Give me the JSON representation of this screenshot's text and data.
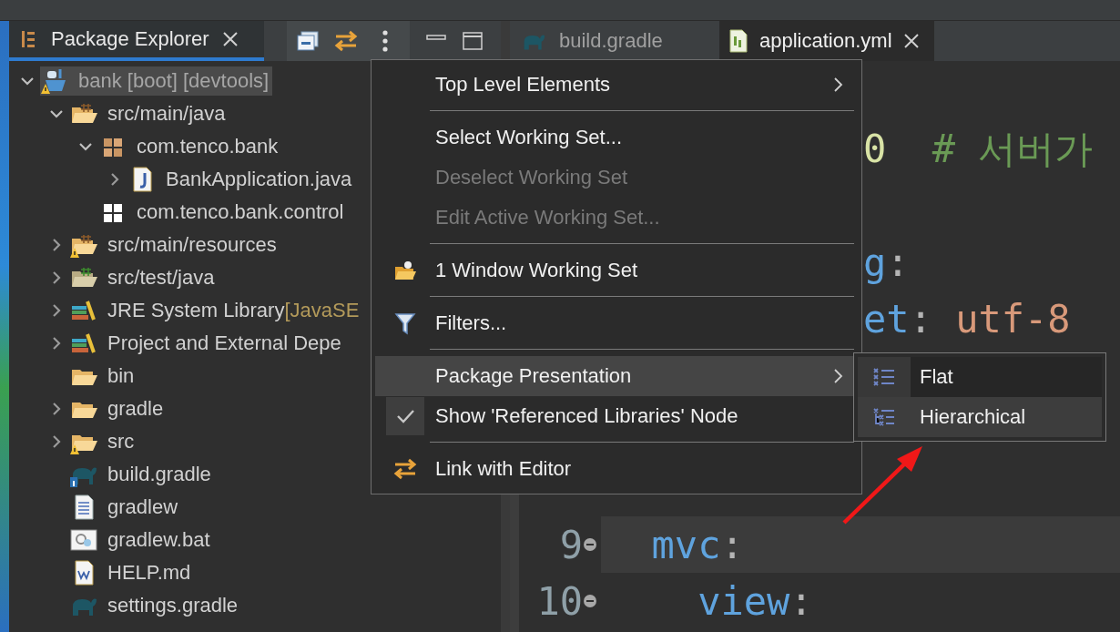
{
  "explorer": {
    "tabs": [
      {
        "label": "Package Explorer",
        "selected": true
      }
    ],
    "tree": [
      {
        "label": "bank [boot] [devtools]",
        "kind": "project",
        "warning": true,
        "expanded": true,
        "selected": true,
        "children": [
          {
            "label": "src/main/java",
            "kind": "source",
            "warning": false,
            "expanded": true,
            "selected": false,
            "children": [
              {
                "label": "com.tenco.bank",
                "kind": "package",
                "warning": false,
                "expanded": true,
                "selected": false,
                "children": [
                  {
                    "label": "BankApplication.java",
                    "kind": "java",
                    "warning": false,
                    "expanded": false,
                    "selected": false
                  }
                ]
              },
              {
                "label": "com.tenco.bank.control",
                "kind": "empty",
                "warning": false,
                "selected": false
              }
            ]
          },
          {
            "label": "src/main/resources",
            "kind": "source",
            "warning": true,
            "expanded": false,
            "selected": false
          },
          {
            "label": "src/test/java",
            "kind": "test",
            "warning": false,
            "expanded": false,
            "selected": false
          },
          {
            "label": "JRE System Library",
            "decoration": "[JavaSE",
            "kind": "library",
            "warning": false,
            "expanded": false,
            "selected": false
          },
          {
            "label": "Project and External Depe",
            "kind": "library",
            "warning": false,
            "expanded": false,
            "selected": false
          },
          {
            "label": "bin",
            "kind": "folder",
            "warning": false,
            "selected": false
          },
          {
            "label": "gradle",
            "kind": "folder",
            "warning": false,
            "expanded": false,
            "selected": false
          },
          {
            "label": "src",
            "kind": "folder",
            "warning": true,
            "expanded": false,
            "selected": false
          },
          {
            "label": "build.gradle",
            "kind": "buildscript",
            "warning": false,
            "selected": false
          },
          {
            "label": "gradlew",
            "kind": "text",
            "warning": false,
            "selected": false
          },
          {
            "label": "gradlew.bat",
            "kind": "batch",
            "warning": false,
            "selected": false
          },
          {
            "label": "HELP.md",
            "kind": "document",
            "warning": false,
            "selected": false
          },
          {
            "label": "settings.gradle",
            "kind": "gradle",
            "warning": false,
            "selected": false
          }
        ]
      }
    ]
  },
  "editor": {
    "tabs": [
      {
        "label": "build.gradle",
        "kind": "gradle",
        "selected": false
      },
      {
        "label": "application.yml",
        "kind": "yaml",
        "selected": true
      }
    ],
    "fragments": [
      {
        "tokens": [
          {
            "kind": "number",
            "text": "0"
          },
          {
            "kind": "comment",
            "text": "  # 서버가"
          }
        ]
      },
      {
        "tokens": [
          {
            "kind": "key",
            "text": "g"
          },
          {
            "kind": "punct",
            "text": ":"
          }
        ]
      },
      {
        "tokens": [
          {
            "kind": "key",
            "text": "et"
          },
          {
            "kind": "punct",
            "text": ": "
          },
          {
            "kind": "string",
            "text": "utf-8"
          }
        ]
      }
    ],
    "lines": [
      {
        "number": "9",
        "current": true,
        "tokens": [
          {
            "kind": "key",
            "text": "  mvc"
          },
          {
            "kind": "punct",
            "text": ":"
          }
        ]
      },
      {
        "number": "10",
        "current": false,
        "tokens": [
          {
            "kind": "key",
            "text": "    view"
          },
          {
            "kind": "punct",
            "text": ":"
          }
        ]
      }
    ]
  },
  "menu": {
    "items": [
      {
        "kind": "plain",
        "label": "Top Level Elements",
        "submenu": true,
        "disabled": false,
        "checked": false,
        "selected": false
      },
      {
        "kind": "separator"
      },
      {
        "kind": "plain",
        "label": "Select Working Set...",
        "submenu": false,
        "disabled": false,
        "checked": false,
        "selected": false
      },
      {
        "kind": "plain",
        "label": "Deselect Working Set",
        "submenu": false,
        "disabled": true,
        "checked": false,
        "selected": false
      },
      {
        "kind": "plain",
        "label": "Edit Active Working Set...",
        "submenu": false,
        "disabled": true,
        "checked": false,
        "selected": false
      },
      {
        "kind": "separator"
      },
      {
        "kind": "folder",
        "label": "1 Window Working Set",
        "submenu": false,
        "disabled": false,
        "checked": false,
        "selected": false
      },
      {
        "kind": "separator"
      },
      {
        "kind": "filter",
        "label": "Filters...",
        "submenu": false,
        "disabled": false,
        "checked": false,
        "selected": false
      },
      {
        "kind": "separator"
      },
      {
        "kind": "plain",
        "label": "Package Presentation",
        "submenu": true,
        "disabled": false,
        "checked": false,
        "selected": true
      },
      {
        "kind": "plain",
        "label": "Show 'Referenced Libraries' Node",
        "submenu": false,
        "disabled": false,
        "checked": true,
        "selected": false
      },
      {
        "kind": "separator"
      },
      {
        "kind": "link",
        "label": "Link with Editor",
        "submenu": false,
        "disabled": false,
        "checked": false,
        "selected": false
      }
    ]
  },
  "submenu": {
    "items": [
      {
        "label": "Flat",
        "kind": "flat",
        "selected": false
      },
      {
        "label": "Hierarchical",
        "kind": "tree",
        "selected": true
      }
    ]
  }
}
